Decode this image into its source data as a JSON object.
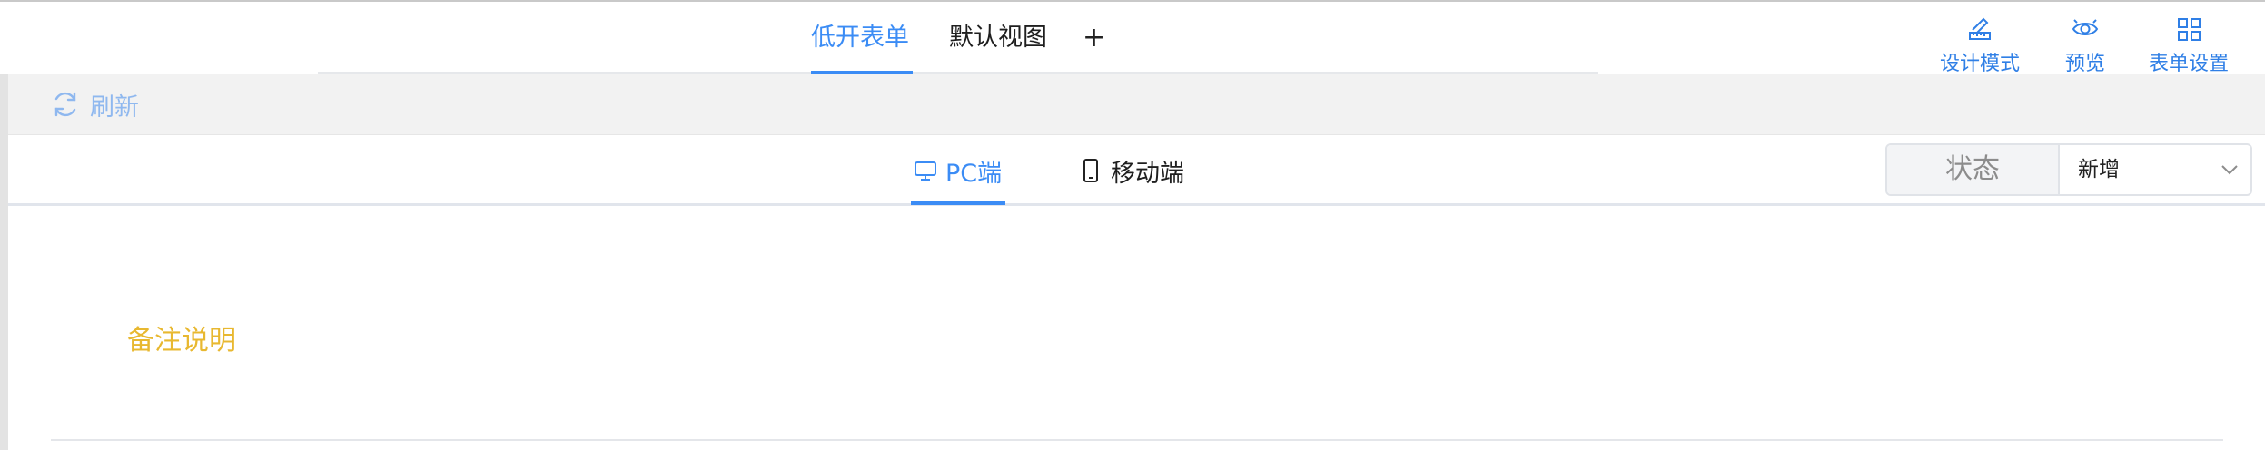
{
  "header": {
    "tabs": [
      {
        "label": "低开表单",
        "active": true
      },
      {
        "label": "默认视图",
        "active": false
      }
    ],
    "add_tab_label": "+",
    "tools": [
      {
        "label": "设计模式",
        "icon": "ruler-pencil-icon"
      },
      {
        "label": "预览",
        "icon": "eye-icon"
      },
      {
        "label": "表单设置",
        "icon": "grid-icon"
      }
    ]
  },
  "toolbar": {
    "refresh_label": "刷新",
    "refresh_icon": "refresh-icon"
  },
  "view_tabs": [
    {
      "label": "PC端",
      "icon": "monitor-icon",
      "active": true
    },
    {
      "label": "移动端",
      "icon": "mobile-icon",
      "active": false
    }
  ],
  "status": {
    "label": "状态",
    "selected": "新增"
  },
  "form": {
    "note_label": "备注说明"
  },
  "colors": {
    "accent": "#3b8cf5",
    "refresh_text": "#8fb8ef",
    "note_text": "#e8b830",
    "toolbar_bg": "#f2f2f2"
  }
}
